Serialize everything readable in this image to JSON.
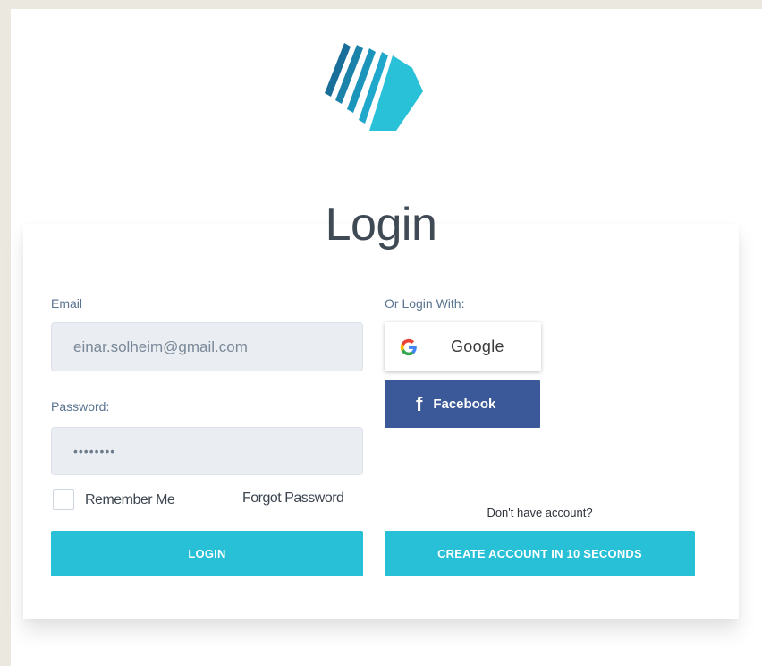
{
  "colors": {
    "accent": "#27c0d6",
    "facebook": "#3b5998",
    "label": "#5a7491",
    "title": "#3f4a55"
  },
  "logo": {
    "icon": "stacked-pages-logo-icon"
  },
  "title": "Login",
  "email": {
    "label": "Email",
    "value": "einar.solheim@gmail.com"
  },
  "password": {
    "label": "Password:",
    "value": "••••••••"
  },
  "remember": {
    "label": "Remember Me",
    "checked": false
  },
  "forgot": {
    "label": "Forgot Password"
  },
  "login_button": {
    "label": "LOGIN"
  },
  "social": {
    "heading": "Or Login With:",
    "google": {
      "label": "Google",
      "icon": "google-icon"
    },
    "facebook": {
      "label": "Facebook",
      "icon": "facebook-icon"
    }
  },
  "signup": {
    "prompt": "Don't have account?",
    "button_label": "CREATE ACCOUNT IN 10 SECONDS"
  }
}
